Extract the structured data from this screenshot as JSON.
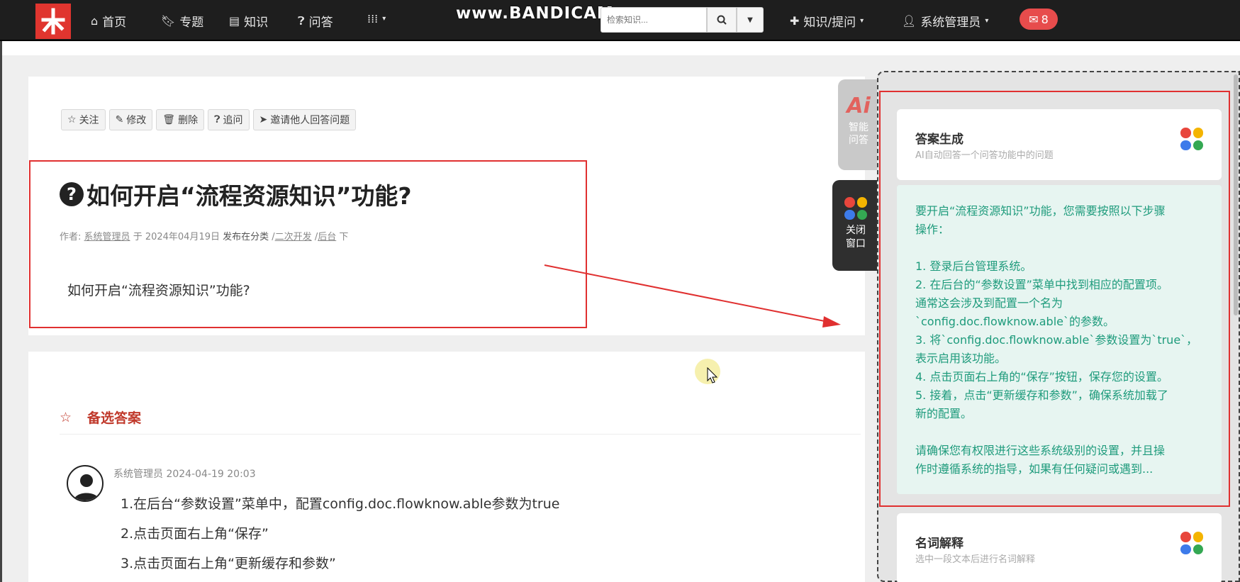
{
  "nav": {
    "home": "首页",
    "topics": "专题",
    "knowledge": "知识",
    "qa": "问答",
    "search_placeholder": "检索知识...",
    "create": "知识/提问",
    "user": "系统管理员",
    "mail_count": "8",
    "watermark": "www.BANDICAM.com"
  },
  "toolbar": {
    "follow": "关注",
    "edit": "修改",
    "delete": "删除",
    "ask_more": "追问",
    "invite": "邀请他人回答问题"
  },
  "question": {
    "title": "如何开启“流程资源知识”功能?",
    "meta_author_prefix": "作者:",
    "author": "系统管理员",
    "meta_at": "于 2024年04月19日",
    "meta_published": "发布在分类",
    "category_1": "二次开发",
    "category_2": "后台",
    "meta_suffix": "下",
    "body": "如何开启“流程资源知识”功能?"
  },
  "answers_section": {
    "title": "备选答案",
    "author": "系统管理员",
    "time": "2024-04-19 20:03",
    "lines": [
      "1.在后台“参数设置”菜单中，配置config.doc.flowknow.able参数为true",
      "2.点击页面右上角“保存”",
      "3.点击页面右上角“更新缓存和参数”"
    ]
  },
  "side": {
    "ai_logo": "Ai",
    "ai_label_1": "智能",
    "ai_label_2": "问答",
    "close_label_1": "关闭",
    "close_label_2": "窗口"
  },
  "ai_panel": {
    "card1_title": "答案生成",
    "card1_desc": "AI自动回答一个问答功能中的问题",
    "answer_lines": [
      "要开启“流程资源知识”功能，您需要按照以下步骤",
      "操作：",
      "",
      "1. 登录后台管理系统。",
      "2. 在后台的“参数设置”菜单中找到相应的配置项。",
      "通常这会涉及到配置一个名为",
      "`config.doc.flowknow.able`的参数。",
      "3. 将`config.doc.flowknow.able`参数设置为`true`，",
      "表示启用该功能。",
      "4. 点击页面右上角的“保存”按钮，保存您的设置。",
      "5. 接着，点击“更新缓存和参数”，确保系统加载了",
      "新的配置。",
      "",
      "请确保您有权限进行这些系统级别的设置，并且操",
      "作时遵循系统的指导，如果有任何疑问或遇到..."
    ],
    "card2_title": "名词解释",
    "card2_desc": "选中一段文本后进行名词解释"
  },
  "colors": {
    "brand_red": "#e0352f",
    "answer_green": "#1e9b7c",
    "dot_red": "#e8463c",
    "dot_yellow": "#f4b400",
    "dot_blue": "#3d7bea",
    "dot_green": "#34a853"
  }
}
